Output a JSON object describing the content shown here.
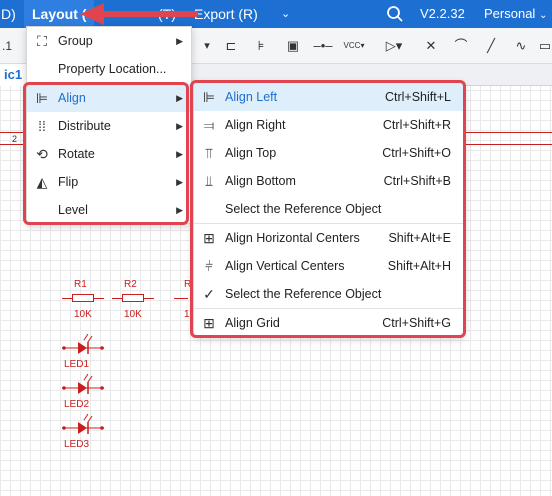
{
  "menubar": {
    "left_fragment": "D)",
    "layout_label": "Layout (",
    "hidden_fragment": "(T)",
    "export_label": "Export (R)",
    "version": "V2.2.32",
    "account": "Personal"
  },
  "toolbar": {
    "zoom_fragment": ".1"
  },
  "tabs": {
    "active": "ic1"
  },
  "layout_menu": {
    "items": [
      {
        "label": "Group",
        "icon": "group-icon",
        "has_submenu": true
      },
      {
        "label": "Property Location...",
        "icon": "",
        "has_submenu": false
      },
      {
        "label": "Align",
        "icon": "align-left-icon",
        "has_submenu": true
      },
      {
        "label": "Distribute",
        "icon": "distribute-icon",
        "has_submenu": true
      },
      {
        "label": "Rotate",
        "icon": "rotate-icon",
        "has_submenu": true
      },
      {
        "label": "Flip",
        "icon": "flip-icon",
        "has_submenu": true
      },
      {
        "label": "Level",
        "icon": "",
        "has_submenu": true
      }
    ]
  },
  "align_menu": {
    "items": [
      {
        "label": "Align Left",
        "shortcut": "Ctrl+Shift+L",
        "icon": "align-left-icon"
      },
      {
        "label": "Align Right",
        "shortcut": "Ctrl+Shift+R",
        "icon": "align-right-icon"
      },
      {
        "label": "Align Top",
        "shortcut": "Ctrl+Shift+O",
        "icon": "align-top-icon"
      },
      {
        "label": "Align Bottom",
        "shortcut": "Ctrl+Shift+B",
        "icon": "align-bottom-icon"
      },
      {
        "label": "Select the Reference Object",
        "shortcut": "",
        "icon": ""
      },
      {
        "label": "Align Horizontal Centers",
        "shortcut": "Shift+Alt+E",
        "icon": "align-h-center-icon"
      },
      {
        "label": "Align Vertical Centers",
        "shortcut": "Shift+Alt+H",
        "icon": "align-v-center-icon"
      },
      {
        "label": "Select the Reference Object",
        "shortcut": "",
        "icon": "check-icon"
      },
      {
        "label": "Align Grid",
        "shortcut": "Ctrl+Shift+G",
        "icon": "align-grid-icon"
      }
    ]
  },
  "canvas": {
    "wire_label": "2",
    "components": {
      "r1": {
        "ref": "R1",
        "value": "10K"
      },
      "r2": {
        "ref": "R2",
        "value": "10K"
      },
      "r3": {
        "ref": "R",
        "value": "1"
      },
      "led1": "LED1",
      "led2": "LED2",
      "led3": "LED3"
    }
  },
  "colors": {
    "menubar": "#1d6fd1",
    "highlight": "#e0454f",
    "schematic": "#c81e1e"
  }
}
